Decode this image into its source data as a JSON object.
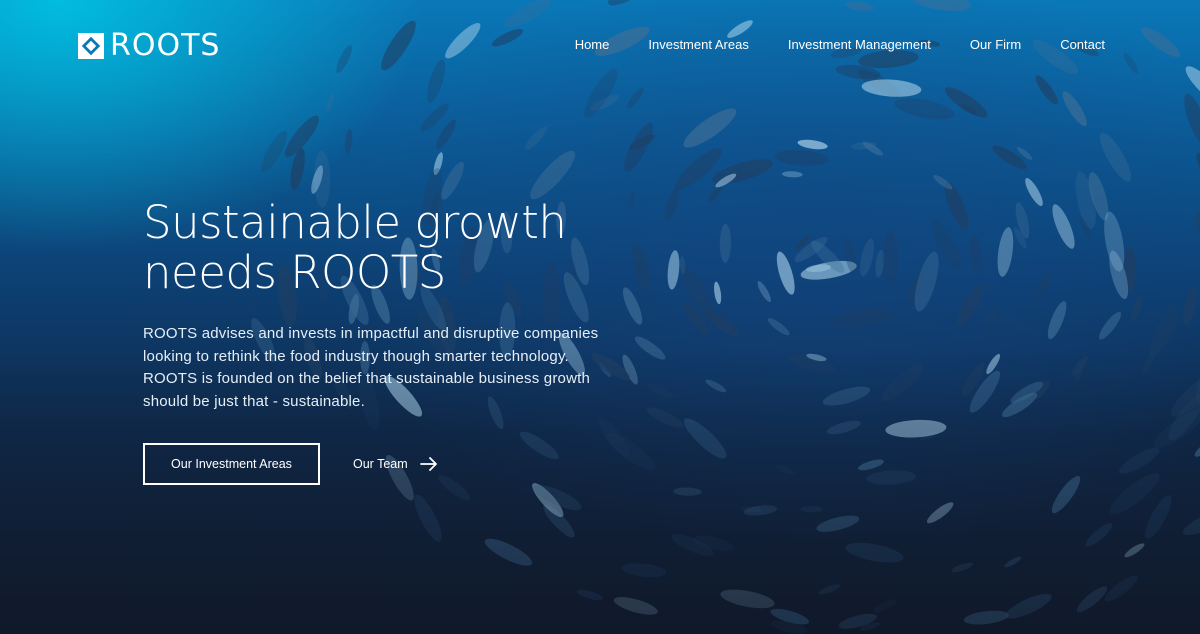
{
  "brand": {
    "name": "ROOTS",
    "logo_icon": "diamond-logo-icon"
  },
  "nav": {
    "items": [
      {
        "label": "Home"
      },
      {
        "label": "Investment Areas"
      },
      {
        "label": "Investment Management"
      },
      {
        "label": "Our Firm"
      },
      {
        "label": "Contact"
      }
    ]
  },
  "hero": {
    "headline_line1": "Sustainable growth",
    "headline_line2": "needs ROOTS",
    "description": "ROOTS advises and invests in impactful and disruptive companies looking to rethink the food industry though smarter technology. ROOTS is founded on the belief that sustainable business growth should be just that - sustainable.",
    "primary_button": "Our Investment Areas",
    "secondary_link": "Our Team",
    "secondary_link_icon": "arrow-right-icon",
    "background": "underwater-fish-school"
  },
  "colors": {
    "text": "#ffffff",
    "water_top": "#0a78b8",
    "water_bottom": "#111c2e",
    "accent_cyan": "#00c8e6"
  }
}
